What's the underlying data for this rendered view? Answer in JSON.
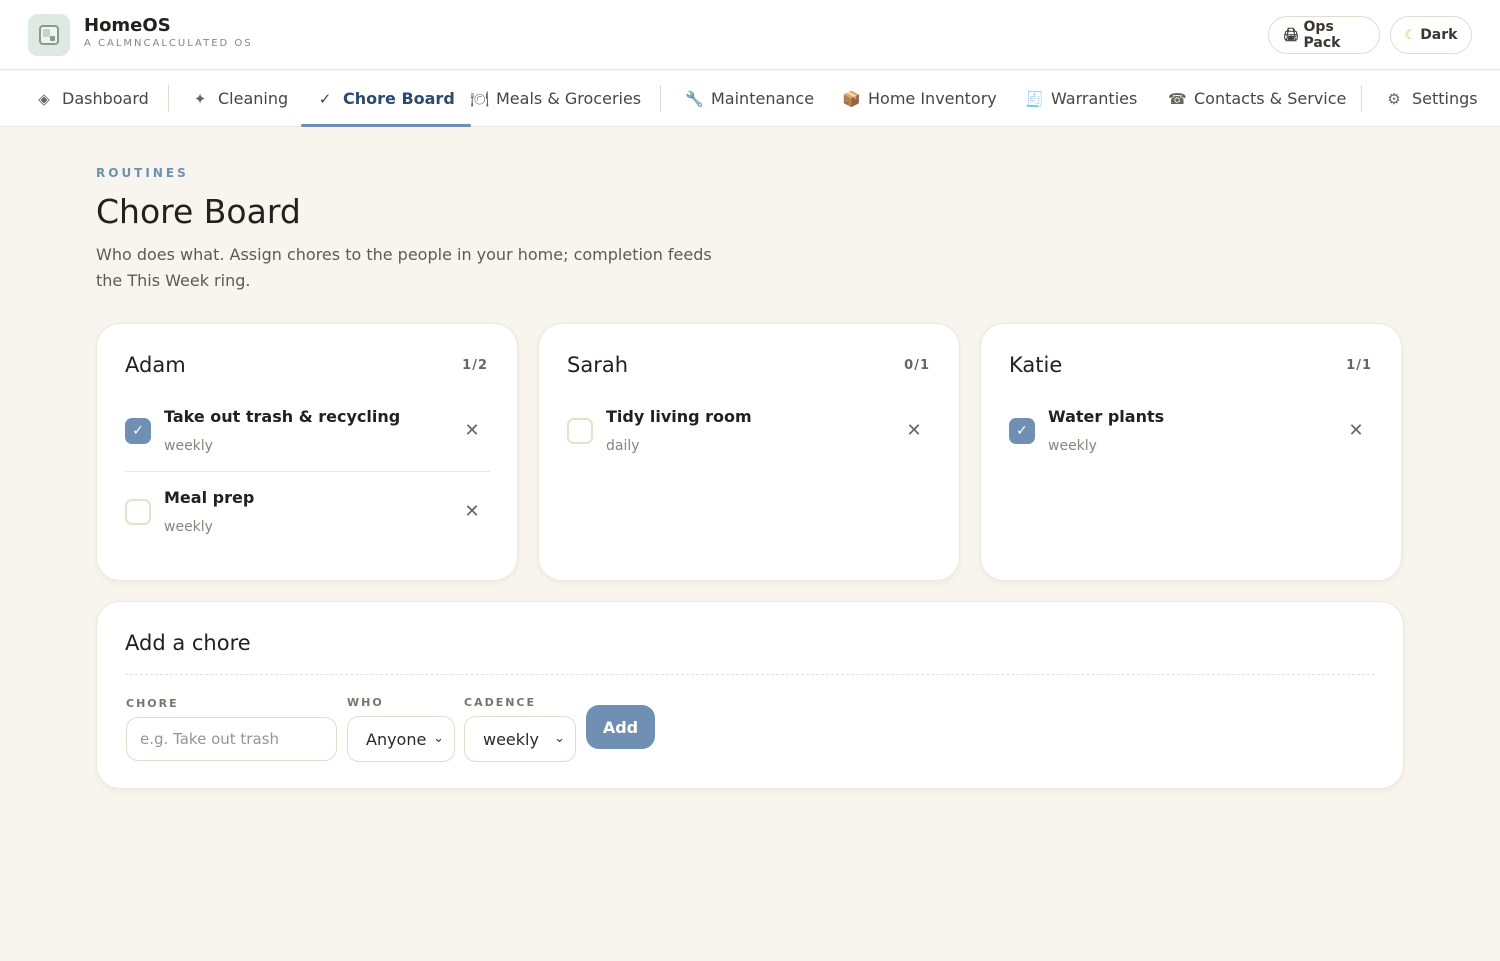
{
  "app": {
    "name": "HomeOS",
    "tagline": "A CALMNCALCULATED OS"
  },
  "header_actions": {
    "ops_pack": "Ops Pack",
    "dark": "Dark"
  },
  "nav": {
    "items": [
      {
        "label": "Dashboard",
        "icon": "diamond-icon"
      },
      {
        "label": "Cleaning",
        "icon": "sparkle-icon"
      },
      {
        "label": "Chore Board",
        "icon": "checkmark-icon",
        "active": true
      },
      {
        "label": "Meals & Groceries",
        "icon": "plate-icon"
      },
      {
        "label": "Maintenance",
        "icon": "wrench-icon"
      },
      {
        "label": "Home Inventory",
        "icon": "box-icon"
      },
      {
        "label": "Warranties",
        "icon": "receipt-icon"
      },
      {
        "label": "Contacts & Service",
        "icon": "phone-icon"
      },
      {
        "label": "Settings",
        "icon": "gear-icon"
      }
    ]
  },
  "page": {
    "eyebrow": "ROUTINES",
    "title": "Chore Board",
    "description": "Who does what. Assign chores to the people in your home; completion feeds the This Week ring."
  },
  "people": [
    {
      "name": "Adam",
      "count": "1/2",
      "chores": [
        {
          "title": "Take out trash & recycling",
          "cadence": "weekly",
          "done": true
        },
        {
          "title": "Meal prep",
          "cadence": "weekly",
          "done": false
        }
      ]
    },
    {
      "name": "Sarah",
      "count": "0/1",
      "chores": [
        {
          "title": "Tidy living room",
          "cadence": "daily",
          "done": false
        }
      ]
    },
    {
      "name": "Katie",
      "count": "1/1",
      "chores": [
        {
          "title": "Water plants",
          "cadence": "weekly",
          "done": true
        }
      ]
    }
  ],
  "add_chore": {
    "title": "Add a chore",
    "chore_label": "CHORE",
    "chore_placeholder": "e.g. Take out trash",
    "who_label": "WHO",
    "who_value": "Anyone",
    "cadence_label": "CADENCE",
    "cadence_value": "weekly",
    "add_label": "Add"
  },
  "colors": {
    "accent": "#6f8fb3",
    "background": "#f8f4ee",
    "active_nav_text": "#2c4a6e"
  }
}
